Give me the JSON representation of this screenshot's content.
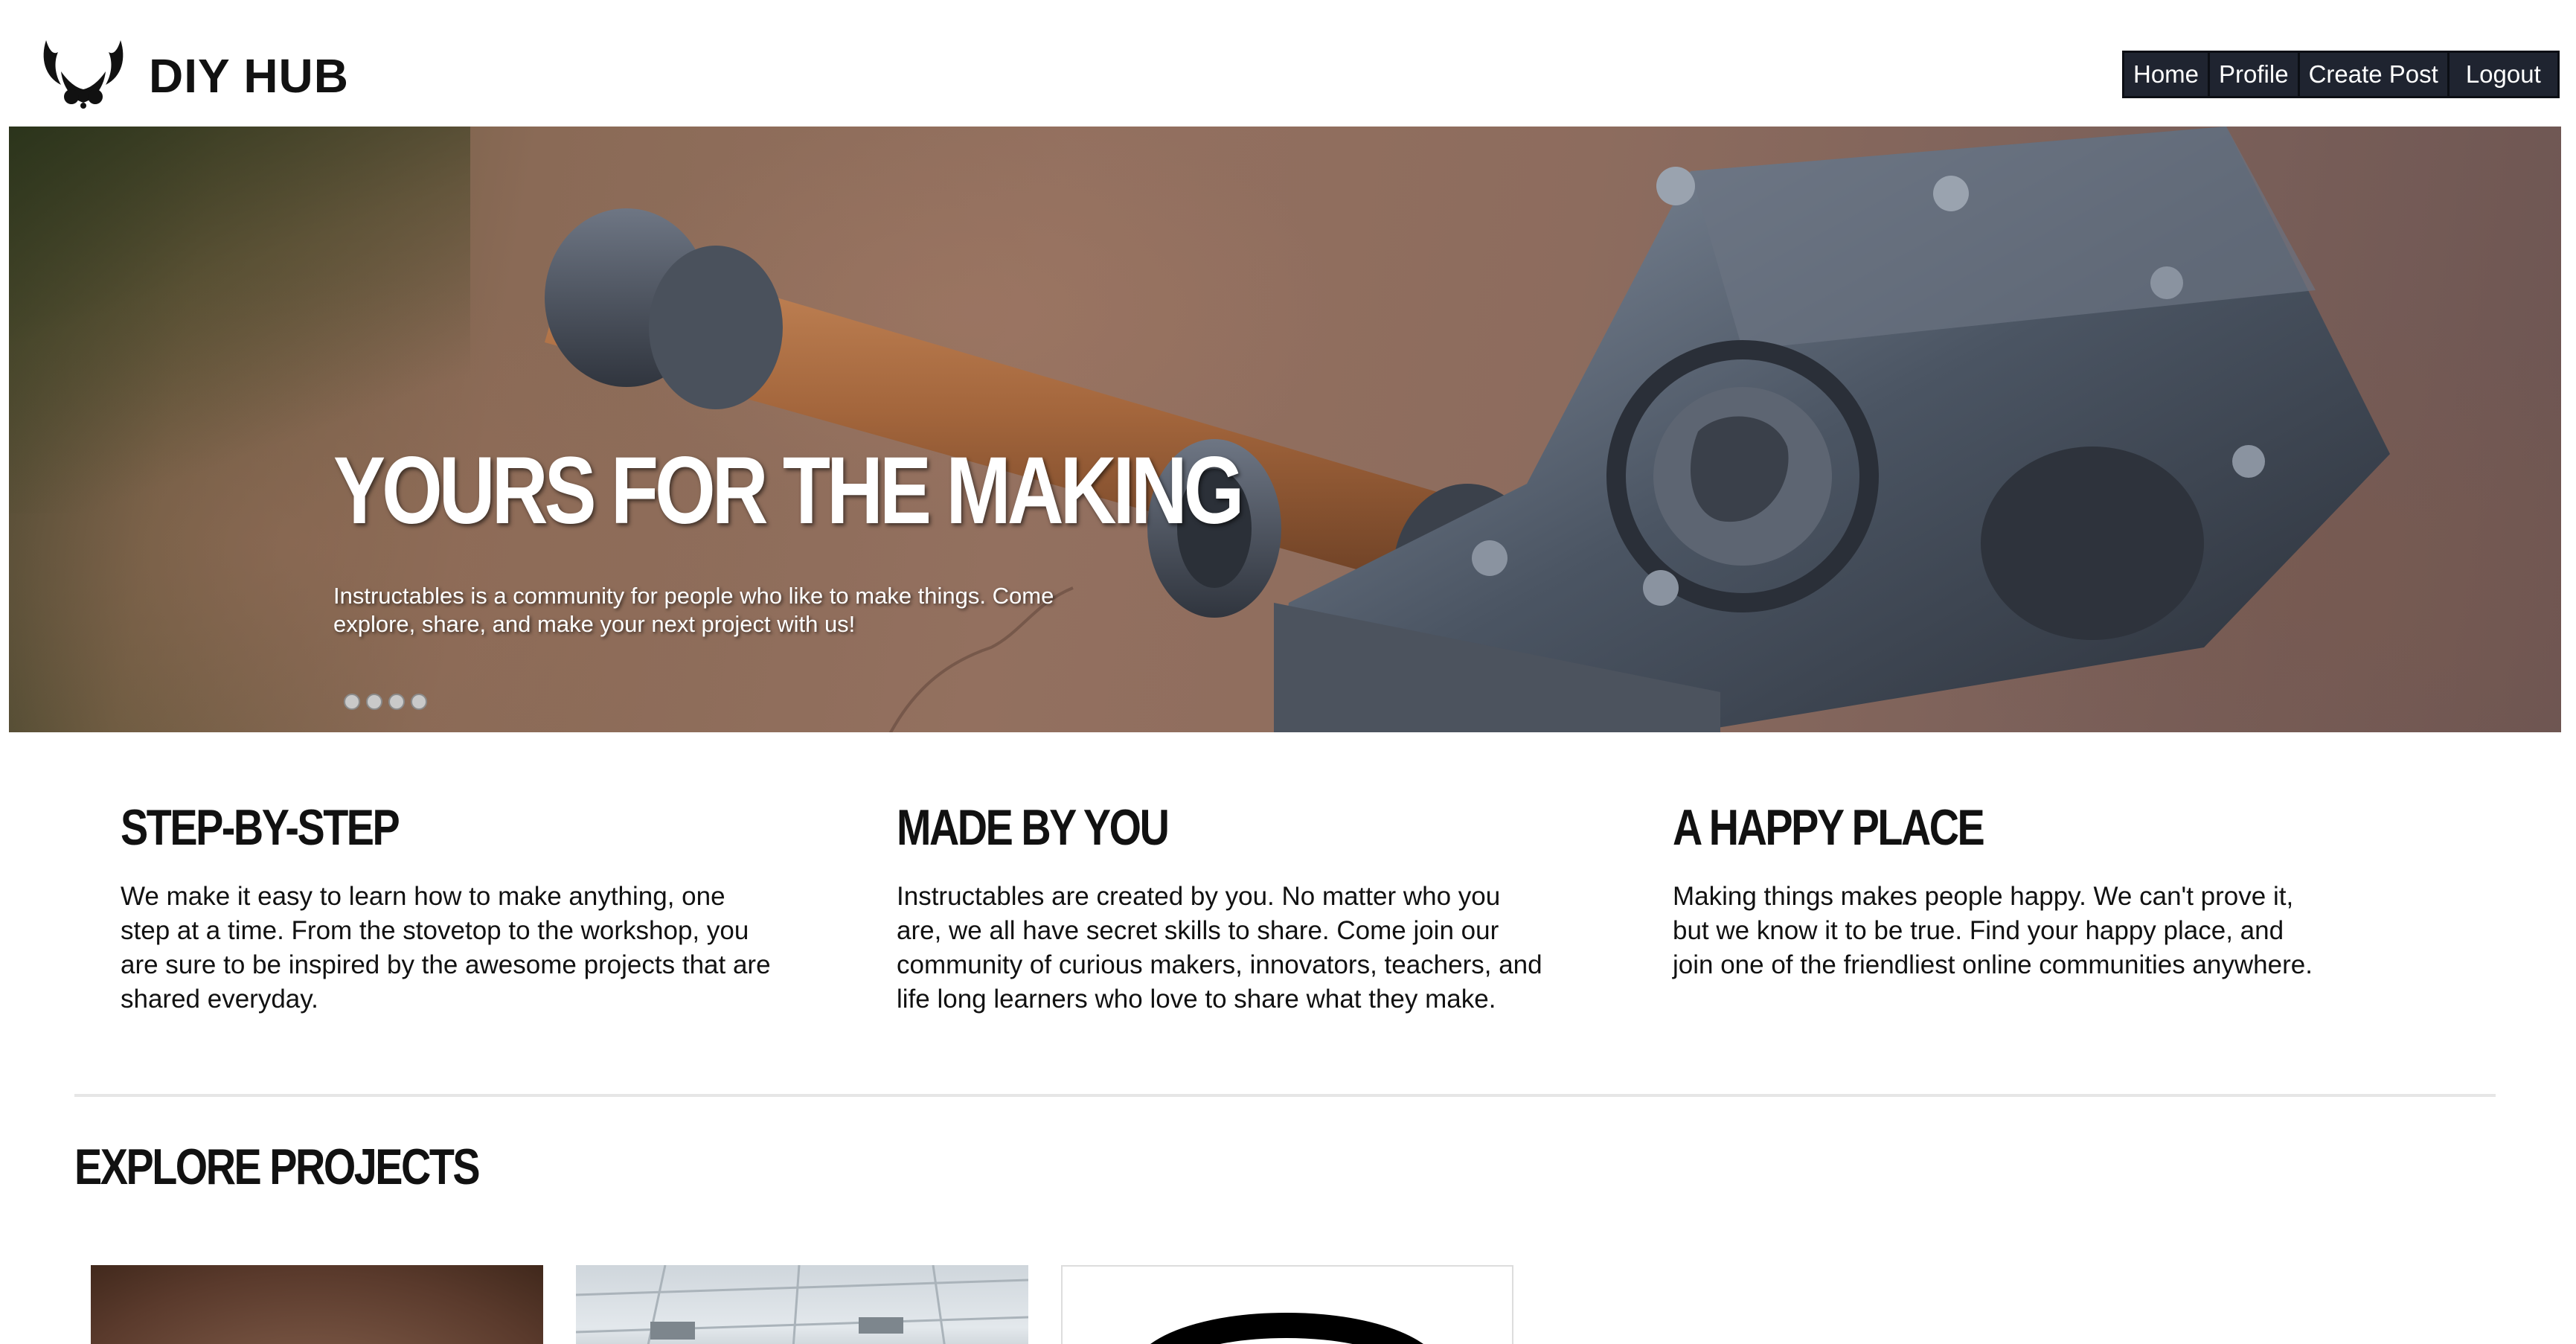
{
  "header": {
    "brand": "DIY HUB",
    "logo_icon": "horned-helmet-logo-icon",
    "nav": [
      "Home",
      "Profile",
      "Create Post",
      "Logout"
    ]
  },
  "hero": {
    "title": "YOURS FOR THE MAKING",
    "subtitle": "Instructables is a community for people who like to make things. Come explore, share, and make your next project with us!",
    "slide_count": 4,
    "image_icon": "warhammer-image"
  },
  "features": [
    {
      "title": "STEP-BY-STEP",
      "text": "We make it easy to learn how to make anything, one step at a time. From the stovetop to the workshop, you are sure to be inspired by the awesome projects that are shared everyday."
    },
    {
      "title": "MADE BY YOU",
      "text": "Instructables are created by you. No matter who you are, we all have secret skills to share. Come join our community of curious makers, innovators, teachers, and life long learners who love to share what they make."
    },
    {
      "title": "A HAPPY PLACE",
      "text": "Making things makes people happy. We can't prove it, but we know it to be true. Find your happy place, and join one of the friendliest online communities anywhere."
    }
  ],
  "explore": {
    "title": "EXPLORE PROJECTS",
    "cards": [
      "project-card-1",
      "project-card-2",
      "project-card-3"
    ]
  },
  "colors": {
    "nav_bg": "#1f2430",
    "text": "#111111",
    "divider": "#e6e6e6"
  }
}
